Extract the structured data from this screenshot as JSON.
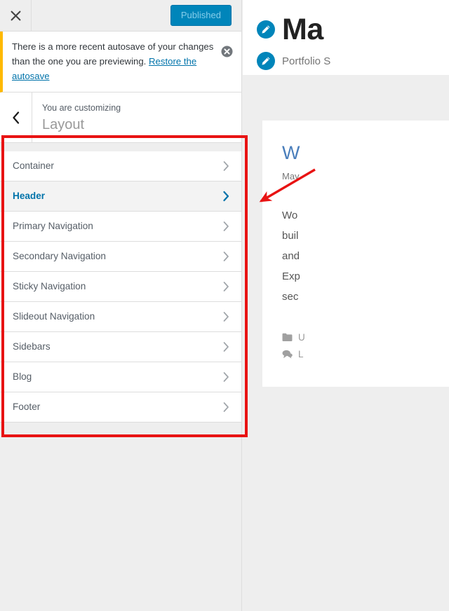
{
  "customizer": {
    "close_label": "Close customizer",
    "publish_label": "Published",
    "notice": {
      "text_before": "There is a more recent autosave of your changes than the one you are previewing. ",
      "link_label": "Restore the autosave",
      "dismiss_label": "Dismiss notice"
    },
    "header": {
      "back_label": "Back",
      "eyebrow": "You are customizing",
      "title": "Layout"
    },
    "sections": [
      {
        "label": "Container",
        "active": false
      },
      {
        "label": "Header",
        "active": true
      },
      {
        "label": "Primary Navigation",
        "active": false
      },
      {
        "label": "Secondary Navigation",
        "active": false
      },
      {
        "label": "Sticky Navigation",
        "active": false
      },
      {
        "label": "Slideout Navigation",
        "active": false
      },
      {
        "label": "Sidebars",
        "active": false
      },
      {
        "label": "Blog",
        "active": false
      },
      {
        "label": "Footer",
        "active": false
      }
    ]
  },
  "preview": {
    "site_title": "Ma",
    "tagline": "Portfolio S",
    "edit_title_label": "Edit site title",
    "edit_tagline_label": "Edit tagline",
    "post": {
      "title": "W",
      "date": "May",
      "excerpt_lines": [
        "Wo",
        "buil",
        "and",
        "Exp",
        "sec"
      ],
      "category": "U",
      "comments": "L"
    }
  },
  "annotations": {
    "highlight_label": "highlight-box-sections",
    "arrow_label": "pointer-arrow"
  },
  "colors": {
    "accent_blue": "#0073aa",
    "publish_blue": "#0085ba",
    "notice_amber": "#ffb900",
    "annotation_red": "#e81313",
    "panel_gray": "#eeeeee"
  }
}
